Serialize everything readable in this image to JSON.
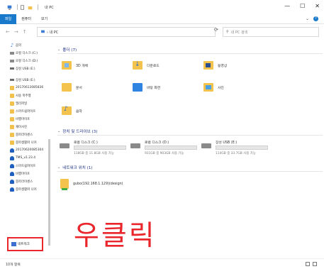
{
  "window": {
    "title": "내 PC",
    "controls": {
      "minimize": "—",
      "maximize": "☐",
      "close": "✕"
    }
  },
  "ribbon": {
    "tabs": [
      {
        "label": "파일",
        "active": true
      },
      {
        "label": "컴퓨터",
        "active": false
      },
      {
        "label": "보기",
        "active": false
      }
    ],
    "help": "?"
  },
  "address": {
    "back": "←",
    "forward": "→",
    "up": "↑",
    "path": "› 내 PC",
    "refresh": "⟳",
    "search_placeholder": "내 PC 검색"
  },
  "sidebar": {
    "items": [
      {
        "label": "음악",
        "icon": "music-icon"
      },
      {
        "label": "로컬 디스크 (C:)",
        "icon": "drive-icon"
      },
      {
        "label": "로컬 디스크 (D:)",
        "icon": "drive-icon"
      },
      {
        "label": "장성 USB (E:)",
        "icon": "usb-icon"
      },
      {
        "label": "",
        "icon": "gap"
      },
      {
        "label": "장성 USB (E:)",
        "icon": "usb-icon"
      },
      {
        "label": "20170613085836",
        "icon": "folder-icon"
      },
      {
        "label": "사용 폭주행",
        "icon": "folder-icon"
      },
      {
        "label": "엘리파일",
        "icon": "folder-icon"
      },
      {
        "label": "스마트쉽파이프",
        "icon": "folder-icon"
      },
      {
        "label": "비행마이프",
        "icon": "folder-icon"
      },
      {
        "label": "재이사진",
        "icon": "folder-icon"
      },
      {
        "label": "중파라이센스",
        "icon": "folder-icon"
      },
      {
        "label": "중파생활파 나커",
        "icon": "folder-icon"
      },
      {
        "label": "20170620085304",
        "icon": "person-icon"
      },
      {
        "label": "TMS_v1.23.4",
        "icon": "person-icon"
      },
      {
        "label": "스마트쉽파이프",
        "icon": "person-icon"
      },
      {
        "label": "비행마이프",
        "icon": "person-icon"
      },
      {
        "label": "중파라이센스",
        "icon": "person-icon"
      },
      {
        "label": "중파생활파 나커",
        "icon": "person-icon"
      }
    ],
    "network": "네트워크"
  },
  "sections": {
    "folders": "폴더 (7)",
    "devices": "장치 및 드라이브 (3)",
    "network_locations": "네트워크 위치 (1)"
  },
  "folders": [
    {
      "name": "3D 개체",
      "kind": "3d"
    },
    {
      "name": "다운로드",
      "kind": "dl"
    },
    {
      "name": "동영상",
      "kind": "vid"
    },
    {
      "name": "문서",
      "kind": "doc"
    },
    {
      "name": "바탕 화면",
      "kind": "desk"
    },
    {
      "name": "사진",
      "kind": "pic"
    },
    {
      "name": "음악",
      "kind": "mus"
    }
  ],
  "drives": [
    {
      "name": "로컬 디스크 (C:)",
      "size": "118GB 중 11.8GB 사용 가능",
      "used_fraction": 0.9
    },
    {
      "name": "로컬 디스크 (D:)",
      "size": "931GB 중 903GB 사용 가능",
      "used_fraction": 0.03
    },
    {
      "name": "장성 USB (E:)",
      "size": "114GB 중 33.7GB 사용 가능",
      "used_fraction": 0.7
    }
  ],
  "network_location": {
    "name": "gubo(192.168.1.129)(design)"
  },
  "annotation": "우클릭",
  "status": {
    "count": "10개 항목"
  },
  "colors": {
    "accent": "#1979ca",
    "annotation": "#e8262c",
    "section": "#1e3287",
    "drive_bar": "#26a0da"
  }
}
